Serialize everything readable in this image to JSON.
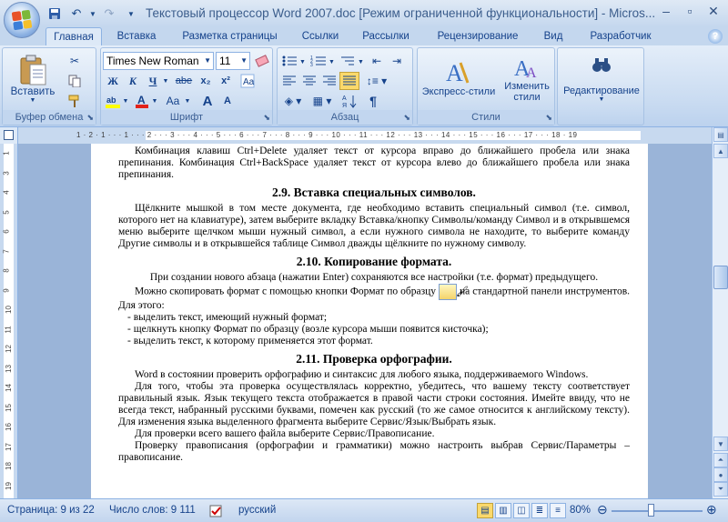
{
  "title_bar": {
    "title": "Текстовый процессор Word 2007.doc [Режим ограниченной функциональности] - Micros...",
    "qat": [
      "save-icon",
      "undo-icon",
      "redo-icon",
      "dropdown-icon"
    ]
  },
  "tabs": [
    "Главная",
    "Вставка",
    "Разметка страницы",
    "Ссылки",
    "Рассылки",
    "Рецензирование",
    "Вид",
    "Разработчик"
  ],
  "ribbon": {
    "clipboard": {
      "paste": "Вставить",
      "label": "Буфер обмена"
    },
    "font": {
      "name": "Times New Roman",
      "size": "11",
      "bold": "Ж",
      "italic": "К",
      "underline": "Ч",
      "strike": "abe",
      "sub": "x₂",
      "sup": "x²",
      "grow": "A",
      "shrink": "A",
      "case": "Aa",
      "label": "Шрифт"
    },
    "paragraph": {
      "label": "Абзац",
      "pilcrow": "¶"
    },
    "styles": {
      "express": "Экспресс-стили",
      "change": "Изменить стили",
      "label": "Стили"
    },
    "editing": {
      "label": "Редактирование"
    }
  },
  "ruler": {
    "marks": "1 · 2 · 1 · · · 1 · · · 2 · · · 3 · · · 4 · · · 5 · · · 6 · · · 7 · · · 8 · · · 9 · · · 10 · · · 11 · · · 12 · · · 13 · · · 14 · · · 15 · · · 16 · · · 17 · · · 18 · 19",
    "v_nums": [
      "1",
      "3",
      "4",
      "5",
      "6",
      "7",
      "8",
      "9",
      "10",
      "11",
      "12",
      "13",
      "14",
      "15",
      "16",
      "17",
      "18",
      "19"
    ]
  },
  "doc": {
    "p1": "Комбинация клавиш Ctrl+Delete удаляет текст от курсора вправо до ближайшего пробела или знака препинания. Комбинация Ctrl+BackSpace удаляет текст от курсора влево до ближайшего пробела или знака препинания.",
    "h1": "2.9. Вставка специальных символов.",
    "p2": "Щёлкните мышкой в том месте документа, где необходимо вставить специальный символ (т.е. символ, которого нет на клавиатуре), затем выберите вкладку Вставка/кнопку Символы/команду Символ и в открывшемся меню выберите щелчком мыши нужный символ, а если нужного символа не находите, то выберите команду Другие символы и в открывшейся таблице Символ дважды щёлкните по нужному символу.",
    "h2": "2.10. Копирование формата.",
    "p3": "При создании нового абзаца (нажатии Enter) сохраняются все настройки (т.е. формат) предыдущего.",
    "p4a": "Можно скопировать формат с помощью кнопки Формат по образцу",
    "p4b": "на стандартной панели инструментов. Для этого:",
    "li1": "выделить текст, имеющий нужный формат;",
    "li2": "щелкнуть кнопку Формат по образцу (возле курсора мыши появится кисточка);",
    "li3": "выделить текст, к которому применяется этот формат.",
    "h3": "2.11. Проверка орфографии.",
    "p5": "Word в состоянии проверить орфографию и синтаксис для любого языка, поддерживаемого Windows.",
    "p6": "Для того, чтобы эта проверка осуществлялась корректно, убедитесь, что вашему тексту соответствует правильный язык. Язык текущего текста отображается в правой части строки состояния. Имейте ввиду, что не всегда текст, набранный русскими буквами, помечен как русский (то же самое относится к английскому тексту). Для изменения языка выделенного фрагмента выберите Сервис/Язык/Выбрать язык.",
    "p7": "Для проверки всего вашего файла выберите Сервис/Правописание.",
    "p8": "Проверку правописания (орфографии и грамматики) можно настроить выбрав Сервис/Параметры – правописание."
  },
  "status": {
    "page": "Страница: 9 из 22",
    "words": "Число слов: 9 111",
    "lang": "русский",
    "zoom": "80%"
  },
  "colors": {
    "accent": "#15428b",
    "ribbon": "#c9dbf1"
  }
}
